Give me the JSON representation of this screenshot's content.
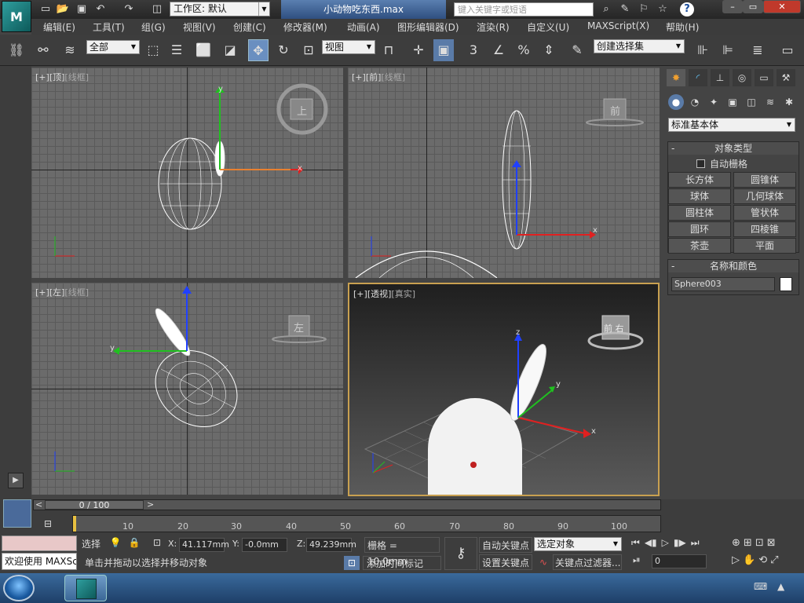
{
  "titlebar": {
    "workspace_label": "工作区: 默认",
    "document_title": "小动物吃东西.max",
    "search_placeholder": "键入关键字或短语",
    "min": "–",
    "max": "▭",
    "close": "✕"
  },
  "menus": [
    "编辑(E)",
    "工具(T)",
    "组(G)",
    "视图(V)",
    "创建(C)",
    "修改器(M)",
    "动画(A)",
    "图形编辑器(D)",
    "渲染(R)",
    "自定义(U)",
    "MAXScript(X)",
    "帮助(H)"
  ],
  "toolbar": {
    "selection_filter": "全部",
    "ref_coord": "视图",
    "snap_label": "3",
    "angle_label": "%",
    "named_selection": "创建选择集"
  },
  "viewports": {
    "top": {
      "bracket1": "[+]",
      "name": "[顶]",
      "mode": "[线框]",
      "cube": "上"
    },
    "front": {
      "bracket1": "[+]",
      "name": "[前]",
      "mode": "[线框]",
      "cube": "前"
    },
    "left": {
      "bracket1": "[+]",
      "name": "[左]",
      "mode": "[线框]",
      "cube": "左"
    },
    "persp": {
      "bracket1": "[+]",
      "name": "[透视]",
      "mode": "[真实]",
      "cube": "前 右"
    }
  },
  "axes": {
    "x": "x",
    "y": "y",
    "z": "z"
  },
  "command_panel": {
    "category": "标准基本体",
    "object_type_title": "对象类型",
    "auto_grid": "自动栅格",
    "buttons": [
      "长方体",
      "圆锥体",
      "球体",
      "几何球体",
      "圆柱体",
      "管状体",
      "圆环",
      "四棱锥",
      "茶壶",
      "平面"
    ],
    "name_color_title": "名称和颜色",
    "object_name": "Sphere003",
    "minus": "-"
  },
  "timeline": {
    "frame_display": "0 / 100",
    "prev": "<",
    "next": ">",
    "ticks": [
      "10",
      "20",
      "30",
      "40",
      "50",
      "60",
      "70",
      "80",
      "90",
      "100"
    ]
  },
  "status": {
    "welcome": "欢迎使用 MAXSc",
    "selected_label": "选择",
    "x_label": "X:",
    "x_value": "41.117mm",
    "y_label": "Y:",
    "y_value": "-0.0mm",
    "z_label": "Z:",
    "z_value": "49.239mm",
    "grid": "栅格 = 10.0mm",
    "prompt": "单击并拖动以选择并移动对象",
    "add_time_tag": "添加时间标记",
    "auto_key": "自动关键点",
    "set_key": "设置关键点",
    "key_mode": "选定对象",
    "key_filters": "关键点过滤器...",
    "current_frame": "0"
  },
  "colors": {
    "active_border": "#c8a050",
    "x_axis": "#e02020",
    "y_axis": "#20c020",
    "z_axis": "#2040ff",
    "selection": "#f0e040"
  }
}
